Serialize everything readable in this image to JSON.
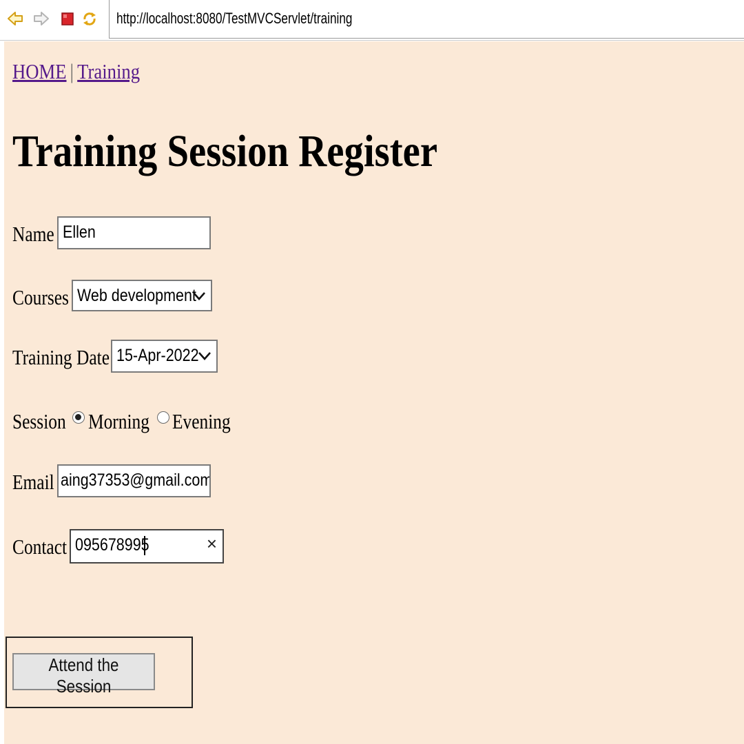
{
  "browser": {
    "url": "http://localhost:8080/TestMVCServlet/training",
    "buttons": [
      {
        "name": "back-icon"
      },
      {
        "name": "forward-icon"
      },
      {
        "name": "stop-icon"
      },
      {
        "name": "refresh-icon"
      }
    ]
  },
  "nav": {
    "home": "HOME",
    "separator": "|",
    "training": "Training"
  },
  "page": {
    "title": "Training Session Register",
    "background": "#fbe9d7"
  },
  "form": {
    "name": {
      "label": "Name",
      "value": "Ellen"
    },
    "courses": {
      "label": "Courses",
      "selected": "Web development"
    },
    "training_date": {
      "label": "Training Date",
      "selected": "15-Apr-2022"
    },
    "session": {
      "label": "Session",
      "options": [
        {
          "label": "Morning",
          "checked": true
        },
        {
          "label": "Evening",
          "checked": false
        }
      ]
    },
    "email": {
      "label": "Email",
      "value": "aing37353@gmail.com"
    },
    "contact": {
      "label": "Contact",
      "value": "095678995",
      "clear_glyph": "×"
    },
    "submit": {
      "label": "Attend the Session"
    }
  },
  "colors": {
    "link": "#551a8b",
    "page_background": "#fbe9d7"
  }
}
